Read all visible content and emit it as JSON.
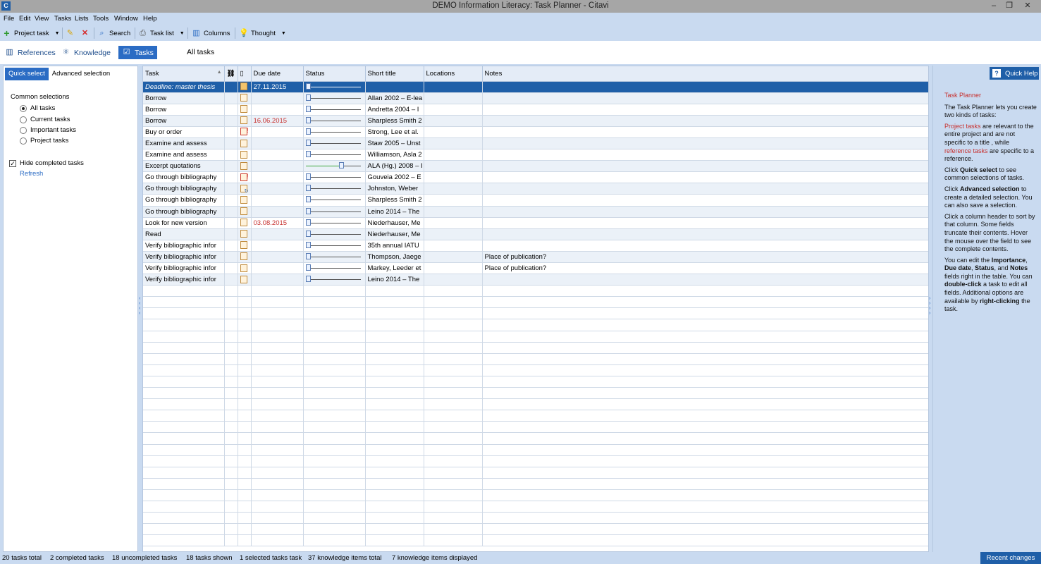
{
  "window": {
    "title": "DEMO Information Literacy: Task Planner - Citavi",
    "controls": [
      "–",
      "❐",
      "✕"
    ]
  },
  "menu": [
    "File",
    "Edit",
    "View",
    "Tasks",
    "Lists",
    "Tools",
    "Window",
    "Help"
  ],
  "toolbar": {
    "project_task": "Project task",
    "search": "Search",
    "task_list": "Task list",
    "columns": "Columns",
    "thought": "Thought"
  },
  "nav": {
    "references": "References",
    "knowledge": "Knowledge",
    "tasks": "Tasks",
    "view_title": "All tasks"
  },
  "left_panel": {
    "tab_quick": "Quick select",
    "tab_advanced": "Advanced selection",
    "section_title": "Common selections",
    "options": [
      "All tasks",
      "Current tasks",
      "Important tasks",
      "Project tasks"
    ],
    "selected_option": "All tasks",
    "hide_completed_label": "Hide completed tasks",
    "hide_completed_checked": true,
    "refresh": "Refresh"
  },
  "grid": {
    "columns": [
      "Task",
      "",
      "",
      "Due date",
      "Status",
      "Short title",
      "Locations",
      "Notes"
    ],
    "rows": [
      {
        "task": "Deadline: master thesis",
        "importance": "normal",
        "due": "27.11.2015",
        "due_overdue": false,
        "status": 0,
        "short_title": "",
        "locations": "",
        "notes": ""
      },
      {
        "task": "Borrow",
        "importance": "normal",
        "due": "",
        "due_overdue": false,
        "status": 0,
        "short_title": "Allan 2002 – E-lea",
        "locations": "",
        "notes": ""
      },
      {
        "task": "Borrow",
        "importance": "normal",
        "due": "",
        "due_overdue": false,
        "status": 0,
        "short_title": "Andretta 2004 – I",
        "locations": "",
        "notes": ""
      },
      {
        "task": "Borrow",
        "importance": "normal",
        "due": "16.06.2015",
        "due_overdue": true,
        "status": 0,
        "short_title": "Sharpless Smith 2",
        "locations": "",
        "notes": ""
      },
      {
        "task": "Buy or order",
        "importance": "high",
        "due": "",
        "due_overdue": false,
        "status": 0,
        "short_title": "Strong, Lee et al.",
        "locations": "",
        "notes": ""
      },
      {
        "task": "Examine and assess",
        "importance": "normal",
        "due": "",
        "due_overdue": false,
        "status": 0,
        "short_title": "Staw 2005 – Unst",
        "locations": "",
        "notes": ""
      },
      {
        "task": "Examine and assess",
        "importance": "normal",
        "due": "",
        "due_overdue": false,
        "status": 0,
        "short_title": "Williamson, Asla 2",
        "locations": "",
        "notes": ""
      },
      {
        "task": "Excerpt quotations",
        "importance": "normal",
        "due": "",
        "due_overdue": false,
        "status": 0.66,
        "short_title": "ALA (Hg.) 2008 – I",
        "locations": "",
        "notes": ""
      },
      {
        "task": "Go through bibliography",
        "importance": "high",
        "due": "",
        "due_overdue": false,
        "status": 0,
        "short_title": "Gouveia 2002 – E",
        "locations": "",
        "notes": ""
      },
      {
        "task": "Go through bibliography",
        "importance": "ref",
        "due": "",
        "due_overdue": false,
        "status": 0,
        "short_title": "Johnston, Weber",
        "locations": "",
        "notes": ""
      },
      {
        "task": "Go through bibliography",
        "importance": "normal",
        "due": "",
        "due_overdue": false,
        "status": 0,
        "short_title": "Sharpless Smith 2",
        "locations": "",
        "notes": ""
      },
      {
        "task": "Go through bibliography",
        "importance": "normal",
        "due": "",
        "due_overdue": false,
        "status": 0,
        "short_title": "Leino 2014 – The",
        "locations": "",
        "notes": ""
      },
      {
        "task": "Look for new version",
        "importance": "normal",
        "due": "03.08.2015",
        "due_overdue": true,
        "status": 0,
        "short_title": "Niederhauser, Me",
        "locations": "",
        "notes": ""
      },
      {
        "task": "Read",
        "importance": "normal",
        "due": "",
        "due_overdue": false,
        "status": 0,
        "short_title": "Niederhauser, Me",
        "locations": "",
        "notes": ""
      },
      {
        "task": "Verify bibliographic infor",
        "importance": "normal",
        "due": "",
        "due_overdue": false,
        "status": 0,
        "short_title": "35th annual IATU",
        "locations": "",
        "notes": ""
      },
      {
        "task": "Verify bibliographic infor",
        "importance": "normal",
        "due": "",
        "due_overdue": false,
        "status": 0,
        "short_title": "Thompson, Jaege",
        "locations": "",
        "notes": "Place of publication?"
      },
      {
        "task": "Verify bibliographic infor",
        "importance": "normal",
        "due": "",
        "due_overdue": false,
        "status": 0,
        "short_title": "Markey, Leeder et",
        "locations": "",
        "notes": "Place of publication?"
      },
      {
        "task": "Verify bibliographic infor",
        "importance": "normal",
        "due": "",
        "due_overdue": false,
        "status": 0,
        "short_title": "Leino 2014 – The",
        "locations": "",
        "notes": ""
      }
    ],
    "selected_row": 0
  },
  "right_panel": {
    "quick_help": "Quick Help"
  },
  "help": {
    "title": "Task Planner",
    "p1": "The Task Planner lets you create two kinds of tasks:",
    "p2_a": "Project tasks",
    "p2_b": " are relevant to the entire project and are not specific to a title , while ",
    "p2_c": "reference tasks",
    "p2_d": " are specific to a reference.",
    "p3_a": "Click ",
    "p3_b": "Quick select",
    "p3_c": " to see common selections of tasks.",
    "p4_a": "Click ",
    "p4_b": "Advanced selection",
    "p4_c": " to create a detailed selection. You can also save a selection.",
    "p5": "Click a column header to sort by that column. Some fields truncate their contents. Hover the mouse over the field to see the complete contents.",
    "p6_a": "You can edit the ",
    "p6_b": "Importance",
    "p6_c": ", ",
    "p6_d": "Due date",
    "p6_e": ", ",
    "p6_f": "Status",
    "p6_g": ", and ",
    "p6_h": "Notes",
    "p6_i": " fields right in the table. You can ",
    "p6_j": "double-click",
    "p6_k": " a task to edit all fields. Additional options are available by ",
    "p6_l": "right-clicking",
    "p6_m": " the task."
  },
  "status": {
    "total": "20 tasks total",
    "completed": "2 completed tasks",
    "uncompleted": "18 uncompleted tasks",
    "shown": "18 tasks shown",
    "selected": "1 selected tasks task",
    "knowledge_total": "37 knowledge items total",
    "knowledge_displayed": "7 knowledge items displayed",
    "recent_changes": "Recent changes"
  },
  "colors": {
    "accent": "#1f5fa8",
    "chrome": "#c9daf0",
    "overdue": "#c7312f"
  }
}
